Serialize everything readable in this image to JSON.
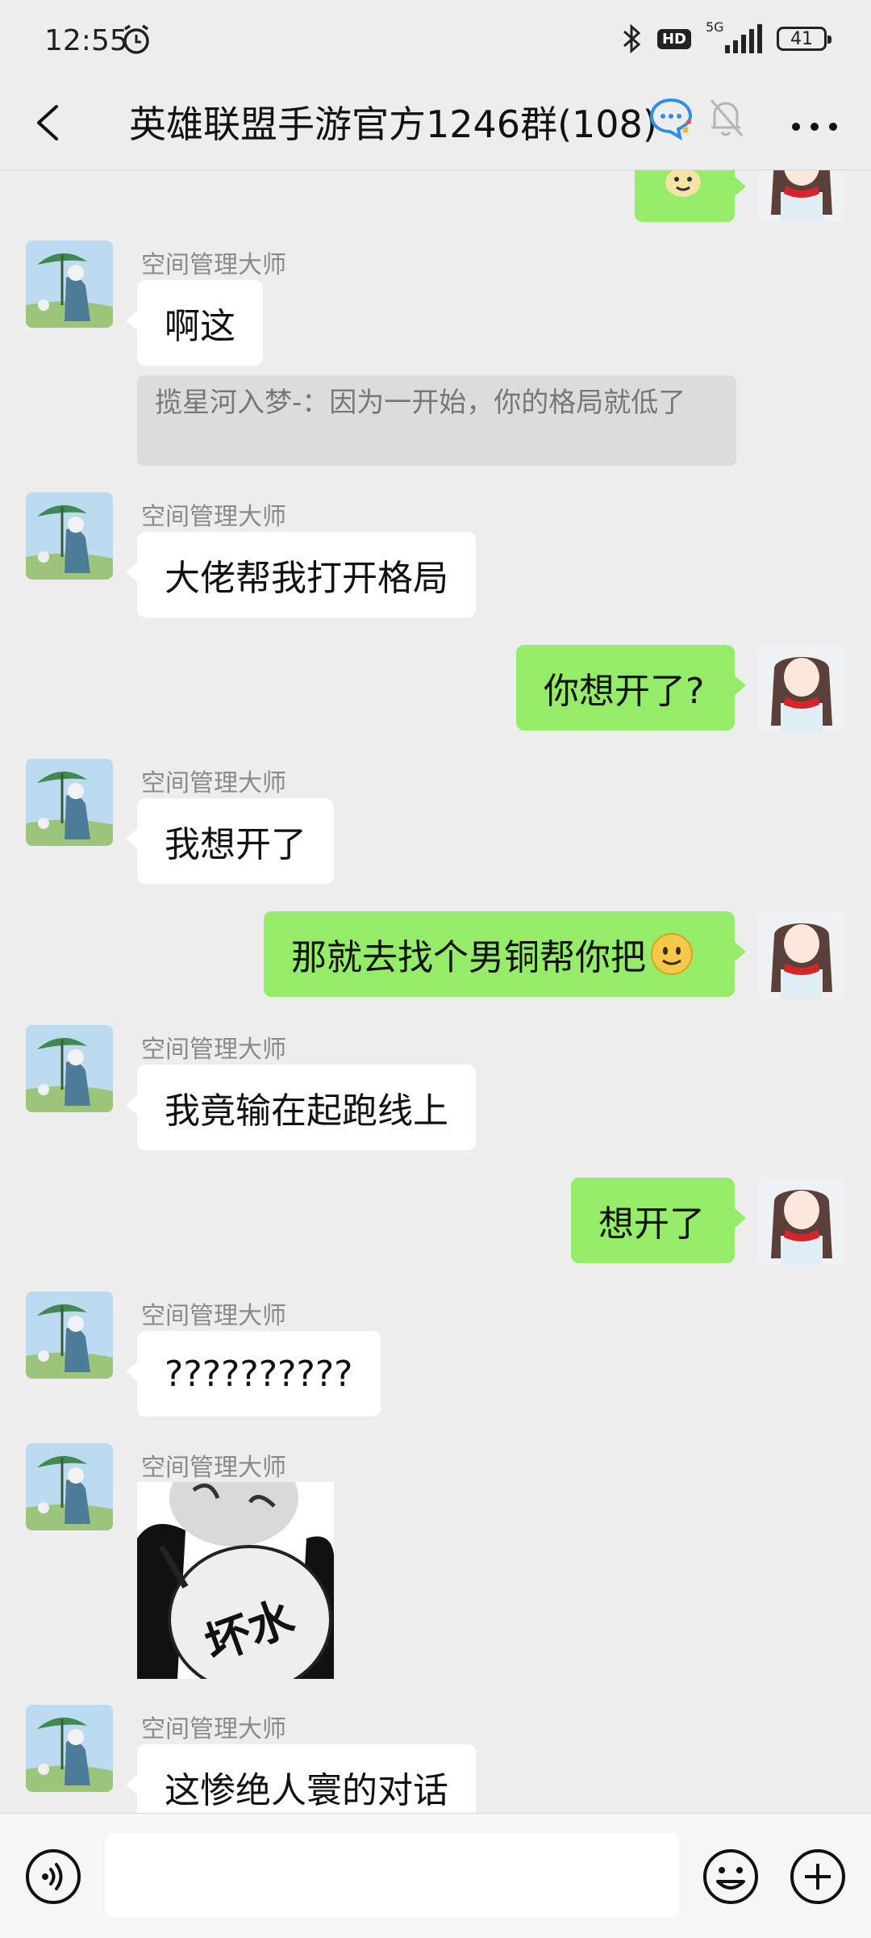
{
  "status_bar": {
    "time": "12:55",
    "network": "5G",
    "hd_label": "HD",
    "battery": "41"
  },
  "header": {
    "title": "英雄联盟手游官方1246群(108)"
  },
  "sender_name": "空间管理大师",
  "messages": [
    {
      "text": "啊这"
    },
    {
      "quote": "揽星河入梦-：因为一开始，你的格局就低了"
    },
    {
      "text": "大佬帮我打开格局"
    },
    {
      "text": "你想开了?"
    },
    {
      "text": "我想开了"
    },
    {
      "text": "那就去找个男铜帮你把"
    },
    {
      "text": "我竟输在起跑线上"
    },
    {
      "text": "想开了"
    },
    {
      "text": "??????????"
    },
    {
      "sticker_text": "坏水"
    },
    {
      "text": "这惨绝人寰的对话"
    }
  ],
  "colors": {
    "background": "#ededed",
    "my_bubble": "#95ec69",
    "their_bubble": "#ffffff",
    "name": "#8a8a8a"
  },
  "icons": [
    "back-arrow-icon",
    "group-chat-icon",
    "mute-bell-icon",
    "more-icon",
    "voice-icon",
    "emoji-icon",
    "plus-icon",
    "alarm-icon",
    "bluetooth-icon",
    "signal-icon",
    "battery-icon"
  ]
}
